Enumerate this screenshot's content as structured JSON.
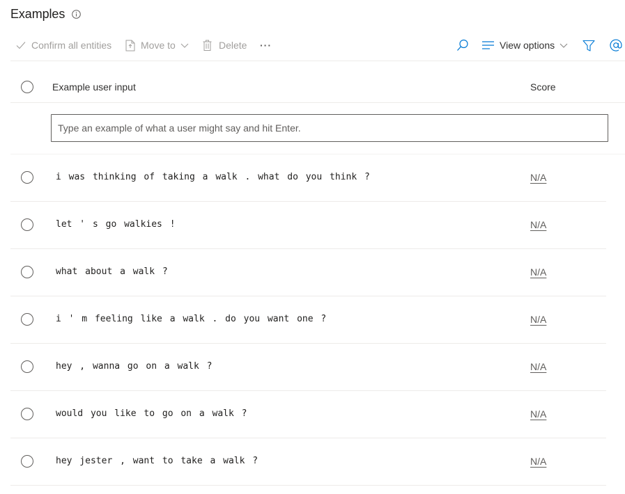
{
  "header": {
    "title": "Examples",
    "info_icon": "info-icon"
  },
  "toolbar": {
    "confirm_all": {
      "label": "Confirm all entities",
      "icon": "checkmark-icon",
      "enabled": false
    },
    "move_to": {
      "label": "Move to",
      "icon": "move-document-icon",
      "enabled": false
    },
    "delete": {
      "label": "Delete",
      "icon": "trash-icon",
      "enabled": false
    },
    "more": {
      "label": "···",
      "icon": "more-icon"
    },
    "search": {
      "icon": "search-icon"
    },
    "view_options": {
      "label": "View options",
      "icon": "lines-icon"
    },
    "filter": {
      "icon": "filter-icon"
    },
    "entity": {
      "icon": "at-sign-icon"
    },
    "accent_color": "#0078d4"
  },
  "table": {
    "columns": {
      "utterance": "Example user input",
      "score": "Score"
    },
    "new_example": {
      "value": "",
      "placeholder": "Type an example of what a user might say and hit Enter."
    },
    "rows": [
      {
        "text": "i was thinking of taking a walk . what do you think ?",
        "score": "N/A"
      },
      {
        "text": "let ' s go walkies !",
        "score": "N/A"
      },
      {
        "text": "what about a walk ?",
        "score": "N/A"
      },
      {
        "text": "i ' m feeling like a walk . do you want one ?",
        "score": "N/A"
      },
      {
        "text": "hey , wanna go on a walk ?",
        "score": "N/A"
      },
      {
        "text": "would you like to go on a walk ?",
        "score": "N/A"
      },
      {
        "text": "hey jester , want to take a walk ?",
        "score": "N/A"
      }
    ]
  }
}
